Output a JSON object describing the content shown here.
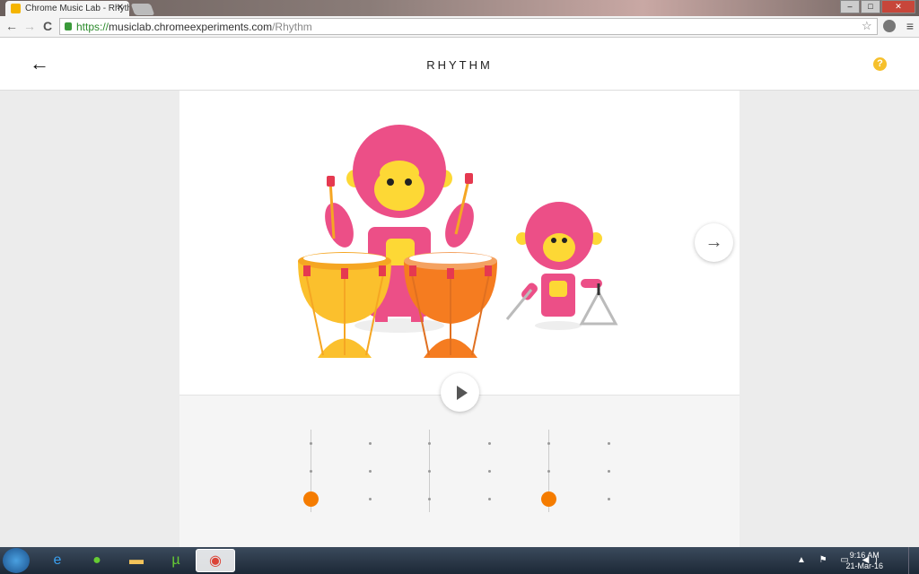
{
  "browser": {
    "tab_title": "Chrome Music Lab - Rhythm",
    "url_scheme": "https://",
    "url_host": "musiclab.chromeexperiments.com",
    "url_path": "/Rhythm",
    "close_tab": "✕",
    "back": "←",
    "forward": "→",
    "reload": "C",
    "star": "☆",
    "menu": "≡",
    "win_min": "–",
    "win_max": "□",
    "win_close": "✕"
  },
  "header": {
    "back": "←",
    "title": "RHYTHM",
    "help": "?"
  },
  "controls": {
    "next": "→"
  },
  "sequencer": {
    "columns": 6,
    "rows": 3,
    "active": [
      {
        "col": 0,
        "row": 2
      },
      {
        "col": 4,
        "row": 2
      }
    ],
    "beat_lines": [
      0,
      2,
      4
    ],
    "active_color": "#f57c00"
  },
  "taskbar": {
    "time": "9:16 AM",
    "date": "21-Mar-16",
    "tray": "▲ ⚑ ▭ ◀)"
  }
}
